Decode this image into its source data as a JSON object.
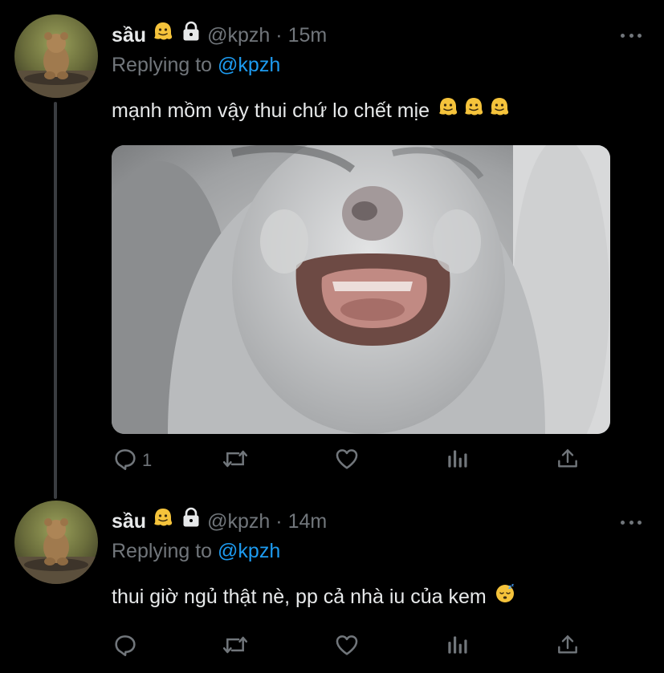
{
  "colors": {
    "background": "#000000",
    "text": "#e7e9ea",
    "muted": "#71767b",
    "mention": "#1d9bf0",
    "thread_line": "#3a3d41"
  },
  "tweets": [
    {
      "name": "sầu",
      "name_emoji": "melting-face-emoji",
      "protected_icon": "lock-icon",
      "handle": "@kpzh",
      "separator": "·",
      "time": "15m",
      "replying_prefix": "Replying to",
      "replying_to": "@kpzh",
      "text": "mạnh mồm vậy thui chứ lo chết mịe",
      "text_emojis": [
        "melting-face-emoji",
        "melting-face-emoji",
        "melting-face-emoji"
      ],
      "media": "cat-photo",
      "actions": {
        "reply_count": "1",
        "retweet_count": "",
        "like_count": ""
      }
    },
    {
      "name": "sầu",
      "name_emoji": "melting-face-emoji",
      "protected_icon": "lock-icon",
      "handle": "@kpzh",
      "separator": "·",
      "time": "14m",
      "replying_prefix": "Replying to",
      "replying_to": "@kpzh",
      "text": "thui giờ ngủ thật nè, pp cả nhà iu của kem",
      "text_emojis": [
        "sleeping-face-emoji"
      ],
      "actions": {
        "reply_count": "",
        "retweet_count": "",
        "like_count": ""
      }
    }
  ]
}
